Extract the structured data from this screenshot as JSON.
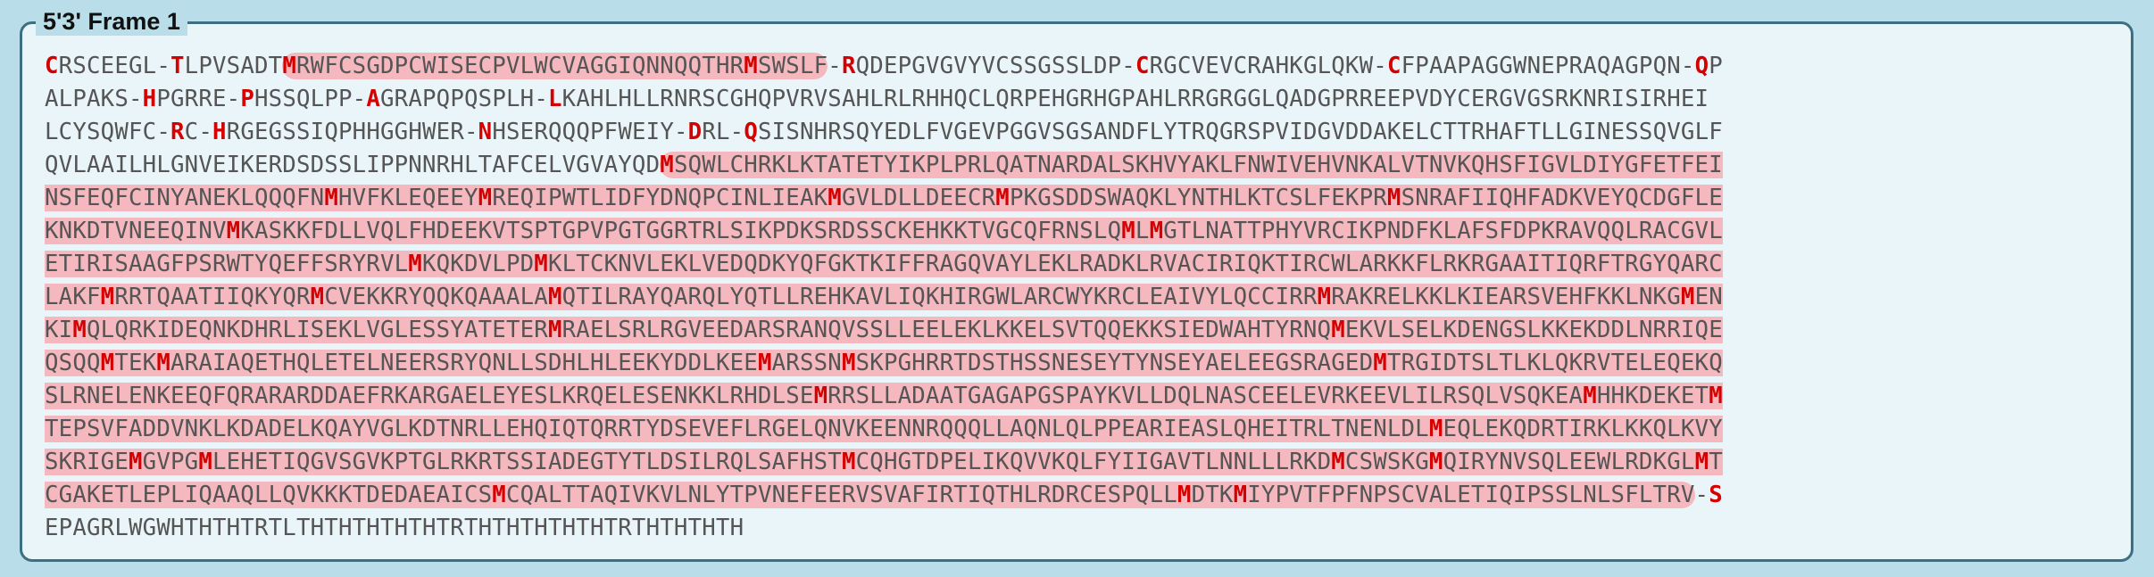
{
  "title": "5'3' Frame 1",
  "colors": {
    "background": "#b9dde9",
    "panel": "#eaf5fa",
    "border": "#3d6f82",
    "orf_highlight": "#f6b8bf",
    "marker": "#d50000",
    "sequence_text": "#555555"
  },
  "sequence_lines": [
    [
      {
        "t": "C",
        "m": true
      },
      {
        "t": "RSCEEGL-"
      },
      {
        "t": "T",
        "m": true
      },
      {
        "t": "LPVSADT"
      },
      {
        "t": "M",
        "m": true,
        "o": "first"
      },
      {
        "t": "RWFCSGDPCWISECPVLWCVAGGIQNNQQTHR",
        "o": "mid"
      },
      {
        "t": "M",
        "m": true,
        "o": "mid"
      },
      {
        "t": "SWSLF",
        "o": "last"
      },
      {
        "t": "-"
      },
      {
        "t": "R",
        "m": true
      },
      {
        "t": "QDEPGVGVYVCSSGSSLDP-"
      },
      {
        "t": "C",
        "m": true
      },
      {
        "t": "RGCVEVCRAHKGLQKW-"
      },
      {
        "t": "C",
        "m": true
      },
      {
        "t": "FPAAPAGGWNEPRAQAGPQN-"
      },
      {
        "t": "Q",
        "m": true
      },
      {
        "t": "P"
      }
    ],
    [
      {
        "t": "ALPAKS-"
      },
      {
        "t": "H",
        "m": true
      },
      {
        "t": "PGRRE-"
      },
      {
        "t": "P",
        "m": true
      },
      {
        "t": "HSSQLPP-"
      },
      {
        "t": "A",
        "m": true
      },
      {
        "t": "GRAPQPQSPLH-"
      },
      {
        "t": "L",
        "m": true
      },
      {
        "t": "KAHLHLLRNRSCGHQPVRVSAHLRLRHHQCLQRPEHGRHGPAHLRRGRGGLQADGPRREEPVDYCERGVGSRKNRISIRHEI"
      }
    ],
    [
      {
        "t": "LCYSQWFC-"
      },
      {
        "t": "R",
        "m": true
      },
      {
        "t": "C-"
      },
      {
        "t": "H",
        "m": true
      },
      {
        "t": "RGEGSSIQPHHGGHWER-"
      },
      {
        "t": "N",
        "m": true
      },
      {
        "t": "HSERQQQPFWEIY-"
      },
      {
        "t": "D",
        "m": true
      },
      {
        "t": "RL-"
      },
      {
        "t": "Q",
        "m": true
      },
      {
        "t": "SISNHRSQYEDLFVGEVPGGVSGSANDFLYTRQGRSPVIDGVDDAKELCTTRHAFTLLGINESSQVGLF"
      }
    ],
    [
      {
        "t": "QVLAAILHLGNVEIKERDSDSSLIPPNNRHLTAFCELVGVAYQD"
      },
      {
        "t": "M",
        "m": true,
        "o": "first"
      },
      {
        "t": "SQWLCHRKLKTATETYIKPLPRLQATNARDALSKHVYAKLFNWIVEHVNKALVTNVKQHSFIGVLDIYGFETFEI",
        "o": "mid"
      }
    ],
    [
      {
        "t": "NSFEQFCINYANEKLQQQFN",
        "o": "mid"
      },
      {
        "t": "M",
        "m": true,
        "o": "mid"
      },
      {
        "t": "HVFKLEQEEY",
        "o": "mid"
      },
      {
        "t": "M",
        "m": true,
        "o": "mid"
      },
      {
        "t": "REQIPWTLIDFYDNQPCINLIEAK",
        "o": "mid"
      },
      {
        "t": "M",
        "m": true,
        "o": "mid"
      },
      {
        "t": "GVLDLLDEECR",
        "o": "mid"
      },
      {
        "t": "M",
        "m": true,
        "o": "mid"
      },
      {
        "t": "PKGSDDSWAQKLYNTHLKTCSLFEKPR",
        "o": "mid"
      },
      {
        "t": "M",
        "m": true,
        "o": "mid"
      },
      {
        "t": "SNRAFIIQHFADKVEYQCDGFLE",
        "o": "mid"
      }
    ],
    [
      {
        "t": "KNKDTVNEEQINV",
        "o": "mid"
      },
      {
        "t": "M",
        "m": true,
        "o": "mid"
      },
      {
        "t": "KASKKFDLLVQLFHDEEKVTSPTGPVPGTGGRTRLSIKPDKSRDSSCKEHKKTVGCQFRNSLQ",
        "o": "mid"
      },
      {
        "t": "M",
        "m": true,
        "o": "mid"
      },
      {
        "t": "L",
        "o": "mid"
      },
      {
        "t": "M",
        "m": true,
        "o": "mid"
      },
      {
        "t": "GTLNATTPHYVRCIKPNDFKLAFSFDPKRAVQQLRACGVL",
        "o": "mid"
      }
    ],
    [
      {
        "t": "ETIRISAAGFPSRWTYQEFFSRYRVL",
        "o": "mid"
      },
      {
        "t": "M",
        "m": true,
        "o": "mid"
      },
      {
        "t": "KQKDVLPD",
        "o": "mid"
      },
      {
        "t": "M",
        "m": true,
        "o": "mid"
      },
      {
        "t": "KLTCKNVLEKLVEDQDKYQFGKTKIFFRAGQVAYLEKLRADKLRVACIRIQKTIRCWLARKKFLRKRGAAITIQRFTRGYQARC",
        "o": "mid"
      }
    ],
    [
      {
        "t": "LAKF",
        "o": "mid"
      },
      {
        "t": "M",
        "m": true,
        "o": "mid"
      },
      {
        "t": "RRTQAATIIQKYQR",
        "o": "mid"
      },
      {
        "t": "M",
        "m": true,
        "o": "mid"
      },
      {
        "t": "CVEKKRYQQKQAAALA",
        "o": "mid"
      },
      {
        "t": "M",
        "m": true,
        "o": "mid"
      },
      {
        "t": "QTILRAYQARQLYQTLLREHKAVLIQKHIRGWLARCWYKRCLEAIVYLQCCIRR",
        "o": "mid"
      },
      {
        "t": "M",
        "m": true,
        "o": "mid"
      },
      {
        "t": "RAKRELKKLKIEARSVEHFKKLNKG",
        "o": "mid"
      },
      {
        "t": "M",
        "m": true,
        "o": "mid"
      },
      {
        "t": "EN",
        "o": "mid"
      }
    ],
    [
      {
        "t": "KI",
        "o": "mid"
      },
      {
        "t": "M",
        "m": true,
        "o": "mid"
      },
      {
        "t": "QLQRKIDEQNKDHRLISEKLVGLESSYATETER",
        "o": "mid"
      },
      {
        "t": "M",
        "m": true,
        "o": "mid"
      },
      {
        "t": "RAELSRLRGVEEDARSRANQVSSLLEELEKLKKELSVTQQEKKSIEDWAHTYRNQ",
        "o": "mid"
      },
      {
        "t": "M",
        "m": true,
        "o": "mid"
      },
      {
        "t": "EKVLSELKDENGSLKKEKDDLNRRIQE",
        "o": "mid"
      }
    ],
    [
      {
        "t": "QSQQ",
        "o": "mid"
      },
      {
        "t": "M",
        "m": true,
        "o": "mid"
      },
      {
        "t": "TEK",
        "o": "mid"
      },
      {
        "t": "M",
        "m": true,
        "o": "mid"
      },
      {
        "t": "ARAIAQETHQLETELNEERSRYQNLLSDHLHLEEKYDDLKEE",
        "o": "mid"
      },
      {
        "t": "M",
        "m": true,
        "o": "mid"
      },
      {
        "t": "ARSSN",
        "o": "mid"
      },
      {
        "t": "M",
        "m": true,
        "o": "mid"
      },
      {
        "t": "SKPGHRRTDSTHSSNESEYTYNSEYAELEEGSRAGED",
        "o": "mid"
      },
      {
        "t": "M",
        "m": true,
        "o": "mid"
      },
      {
        "t": "TRGIDTSLTLKLQKRVTELEQEKQ",
        "o": "mid"
      }
    ],
    [
      {
        "t": "SLRNELENKEEQFQRARARDDAEFRKARGAELEYESLKRQELESENKKLRHDLSE",
        "o": "mid"
      },
      {
        "t": "M",
        "m": true,
        "o": "mid"
      },
      {
        "t": "RRSLLADAATGAGAPGSPAYKVLLDQLNASCEELEVRKEEVLILRSQLVSQKEA",
        "o": "mid"
      },
      {
        "t": "M",
        "m": true,
        "o": "mid"
      },
      {
        "t": "HHKDEKET",
        "o": "mid"
      },
      {
        "t": "M",
        "m": true,
        "o": "mid"
      }
    ],
    [
      {
        "t": "TEPSVFADDVNKLKDADELKQAYVGLKDTNRLLEHQIQTQRRTYDSEVEFLRGELQNVKEENNRQQQLLAQNLQLPPEARIEASLQHEITRLTNENLDL",
        "o": "mid"
      },
      {
        "t": "M",
        "m": true,
        "o": "mid"
      },
      {
        "t": "EQLEKQDRTIRKLKKQLKVY",
        "o": "mid"
      }
    ],
    [
      {
        "t": "SKRIGE",
        "o": "mid"
      },
      {
        "t": "M",
        "m": true,
        "o": "mid"
      },
      {
        "t": "GVPG",
        "o": "mid"
      },
      {
        "t": "M",
        "m": true,
        "o": "mid"
      },
      {
        "t": "LEHETIQGVSGVKPTGLRKRTSSIADEGTYTLDSILRQLSAFHST",
        "o": "mid"
      },
      {
        "t": "M",
        "m": true,
        "o": "mid"
      },
      {
        "t": "CQHGTDPELIKQVVKQLFYIIGAVTLNNLLLRKD",
        "o": "mid"
      },
      {
        "t": "M",
        "m": true,
        "o": "mid"
      },
      {
        "t": "CSWSKG",
        "o": "mid"
      },
      {
        "t": "M",
        "m": true,
        "o": "mid"
      },
      {
        "t": "QIRYNVSQLEEWLRDKGL",
        "o": "mid"
      },
      {
        "t": "M",
        "m": true,
        "o": "mid"
      },
      {
        "t": "T",
        "o": "mid"
      }
    ],
    [
      {
        "t": "CGAKETLEPLIQAAQLLQVKKKTDEDAEAICS",
        "o": "mid"
      },
      {
        "t": "M",
        "m": true,
        "o": "mid"
      },
      {
        "t": "CQALTTAQIVKVLNLYTPVNEFEERVSVAFIRTIQTHLRDRCESPQLL",
        "o": "mid"
      },
      {
        "t": "M",
        "m": true,
        "o": "mid"
      },
      {
        "t": "DTK",
        "o": "mid"
      },
      {
        "t": "M",
        "m": true,
        "o": "mid"
      },
      {
        "t": "IYPVTFPFNPSCVALETIQIPSSLNLSFLTRV",
        "o": "last"
      },
      {
        "t": "-"
      },
      {
        "t": "S",
        "m": true
      }
    ],
    [
      {
        "t": "EPAGRLWGWHTHTHTRTLTHTHTHTHTHTRTHTHTHTHTHTRTHTHTHTH"
      }
    ]
  ]
}
